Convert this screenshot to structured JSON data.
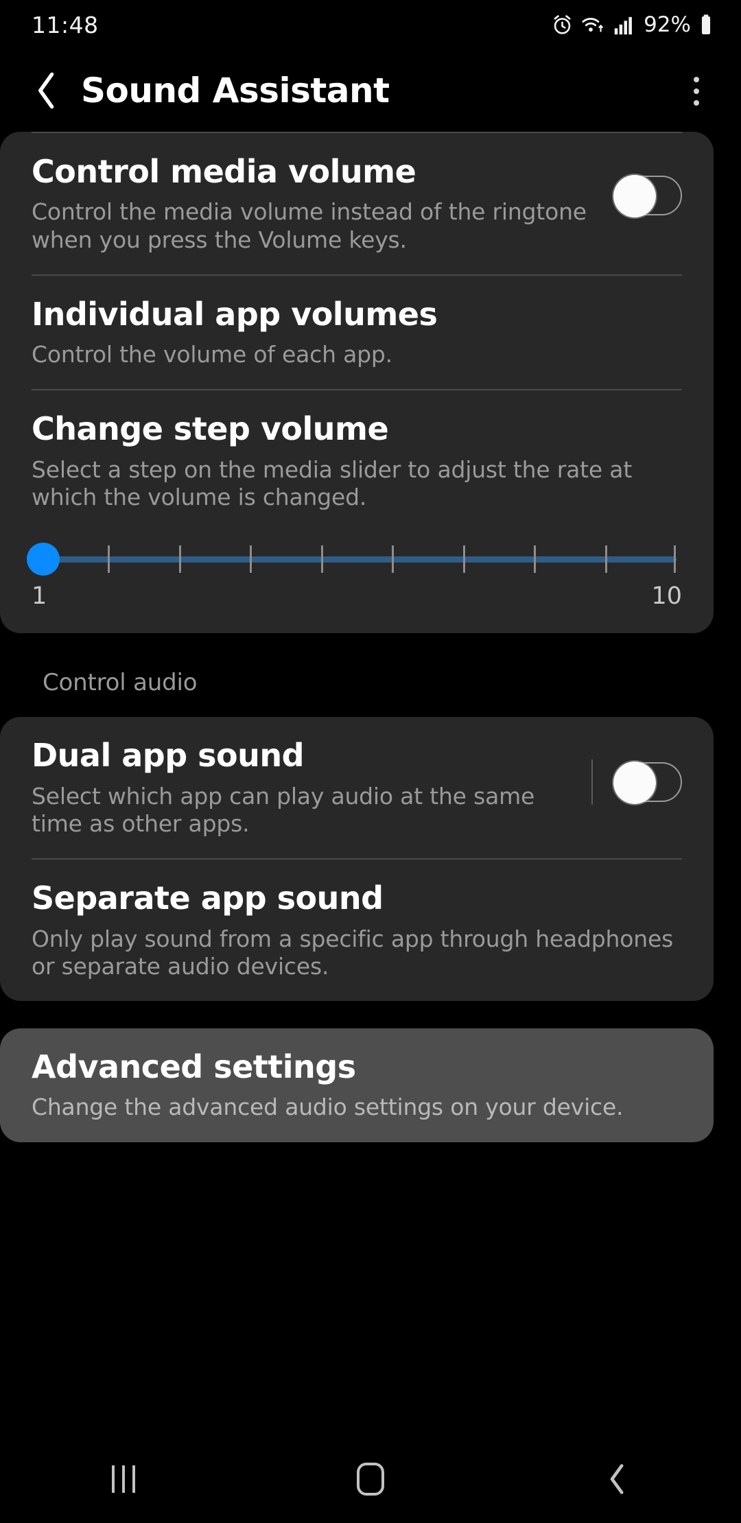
{
  "status_bar": {
    "time": "11:48",
    "battery_percent": "92%",
    "icons": [
      "alarm-icon",
      "wifi-icon",
      "signal-icon",
      "battery-icon"
    ]
  },
  "app_bar": {
    "title": "Sound Assistant",
    "back_label": "Back",
    "overflow_label": "More options"
  },
  "sections": [
    {
      "id": "volume-card",
      "header": null,
      "highlight": false,
      "top_divider": true,
      "rows": [
        {
          "id": "control-media-volume",
          "title": "Control media volume",
          "desc": "Control the media volume instead of the ringtone when you press the Volume keys.",
          "control": "toggle",
          "toggle_on": false,
          "toggle_separator": false
        },
        {
          "id": "individual-app-volumes",
          "title": "Individual app volumes",
          "desc": "Control the volume of each app.",
          "control": "none"
        },
        {
          "id": "change-step-volume",
          "title": "Change step volume",
          "desc": "Select a step on the media slider to adjust the rate at which the volume is changed.",
          "control": "slider"
        }
      ]
    },
    {
      "id": "control-audio-card",
      "header": "Control audio",
      "highlight": false,
      "top_divider": false,
      "rows": [
        {
          "id": "dual-app-sound",
          "title": "Dual app sound",
          "desc": "Select which app can play audio at the same time as other apps.",
          "control": "toggle",
          "toggle_on": false,
          "toggle_separator": true
        },
        {
          "id": "separate-app-sound",
          "title": "Separate app sound",
          "desc": "Only play sound from a specific app through headphones or separate audio devices.",
          "control": "none"
        }
      ]
    },
    {
      "id": "advanced-card",
      "header": null,
      "highlight": true,
      "top_divider": false,
      "rows": [
        {
          "id": "advanced-settings",
          "title": "Advanced settings",
          "desc": "Change the advanced audio settings on your device.",
          "control": "none"
        }
      ]
    }
  ],
  "step_slider": {
    "min_label": "1",
    "max_label": "10",
    "value": 1,
    "min": 1,
    "max": 10,
    "thumb_color": "#0a8bff",
    "track_color": "#2f5d87",
    "tick_color": "#8d8d8d"
  },
  "nav_bar": {
    "recents_label": "Recents",
    "home_label": "Home",
    "back_label": "Back"
  },
  "colors": {
    "background": "#000000",
    "card": "#282828",
    "card_highlight": "#4e4e4e",
    "title_text": "#ffffff",
    "desc_text": "#9a9a9a",
    "accent": "#0a8bff"
  }
}
